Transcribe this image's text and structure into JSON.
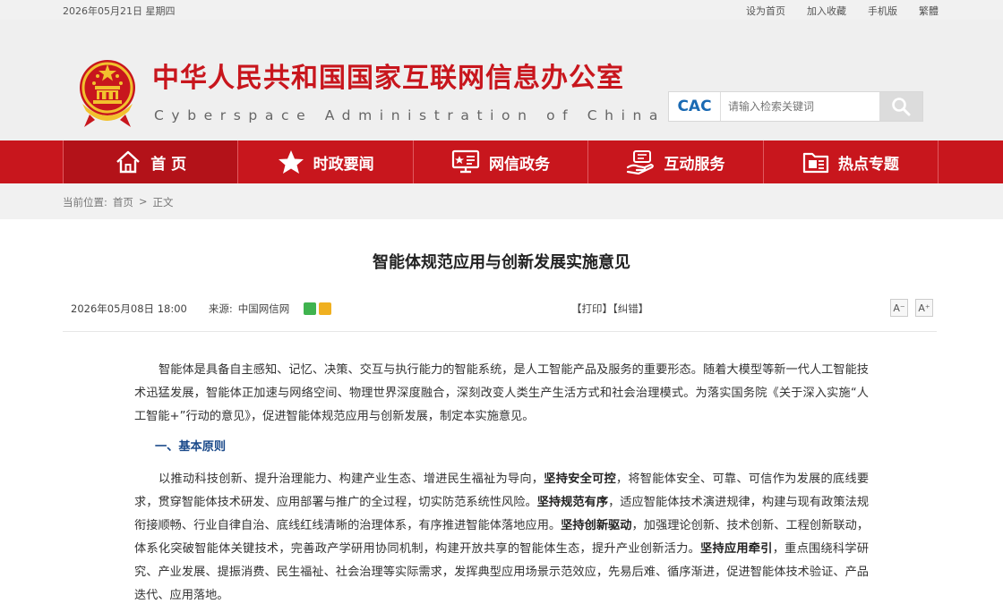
{
  "topbar": {
    "date": "2026年05月21日 星期四",
    "links": [
      "设为首页",
      "加入收藏",
      "手机版",
      "繁體"
    ]
  },
  "header": {
    "title": "中华人民共和国国家互联网信息办公室",
    "subtitle": "Cyberspace Administration of China",
    "logo_label": "CAC",
    "search_placeholder": "请输入检索关键词"
  },
  "nav": {
    "items": [
      {
        "label": "首 页",
        "icon": "home-icon"
      },
      {
        "label": "时政要闻",
        "icon": "star-icon"
      },
      {
        "label": "网信政务",
        "icon": "monitor-icon"
      },
      {
        "label": "互动服务",
        "icon": "hand-icon"
      },
      {
        "label": "热点专题",
        "icon": "folder-icon"
      }
    ]
  },
  "breadcrumb": {
    "prefix": "当前位置:",
    "home": "首页",
    "sep": ">",
    "current": "正文"
  },
  "article": {
    "title": "智能体规范应用与创新发展实施意见",
    "datetime": "2026年05月08日 18:00",
    "source_label": "来源:",
    "source": "中国网信网",
    "print_label": "【打印】",
    "correct_label": "【纠错】",
    "font_decrease": "A⁻",
    "font_increase": "A⁺",
    "intro": "智能体是具备自主感知、记忆、决策、交互与执行能力的智能系统，是人工智能产品及服务的重要形态。随着大模型等新一代人工智能技术迅猛发展，智能体正加速与网络空间、物理世界深度融合，深刻改变人类生产生活方式和社会治理模式。为落实国务院《关于深入实施“人工智能+”行动的意见》，促进智能体规范应用与创新发展，制定本实施意见。",
    "section1_heading": "一、基本原则",
    "p2_a": "以推动科技创新、提升治理能力、构建产业生态、增进民生福祉为导向，",
    "p2_b1": "坚持安全可控",
    "p2_c": "，将智能体安全、可靠、可信作为发展的底线要求，贯穿智能体技术研发、应用部署与推广的全过程，切实防范系统性风险。",
    "p2_b2": "坚持规范有序",
    "p2_d": "，适应智能体技术演进规律，构建与现有政策法规衔接顺畅、行业自律自治、底线红线清晰的治理体系，有序推进智能体落地应用。",
    "p2_b3": "坚持创新驱动",
    "p2_e": "，加强理论创新、技术创新、工程创新联动，体系化突破智能体关键技术，完善政产学研用协同机制，构建开放共享的智能体生态，提升产业创新活力。",
    "p2_b4": "坚持应用牵引",
    "p2_f": "，重点围绕科学研究、产业发展、提振消费、民生福祉、社会治理等实际需求，发挥典型应用场景示范效应，先易后难、循序渐进，促进智能体技术验证、产品迭代、应用落地。"
  },
  "colors": {
    "brand_red": "#c8161d",
    "heading_blue": "#1b4a8a",
    "cac_blue": "#1a6ab3"
  }
}
